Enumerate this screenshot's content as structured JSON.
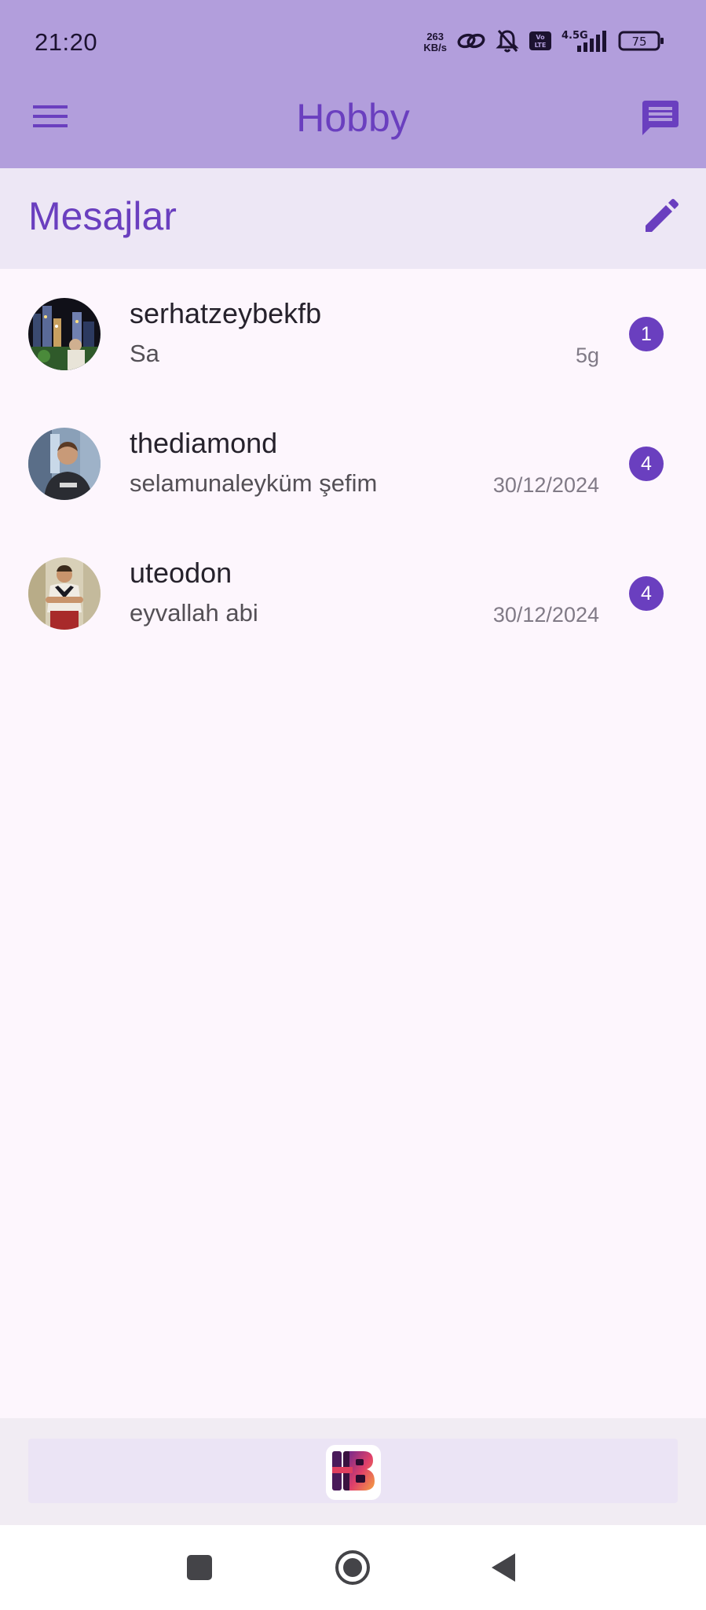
{
  "status_bar": {
    "time": "21:20",
    "net_speed_value": "263",
    "net_speed_unit": "KB/s",
    "network_type": "4.5G",
    "volte_label": "Vo LTE",
    "battery_level": "75",
    "icons": [
      "link-icon",
      "bell-off-icon",
      "volte-icon",
      "signal-icon",
      "battery-icon"
    ]
  },
  "app_bar": {
    "title": "Hobby",
    "menu_icon": "menu-icon",
    "action_icon": "chat-icon"
  },
  "section": {
    "title": "Mesajlar",
    "action_icon": "edit-icon"
  },
  "conversations": [
    {
      "name": "serhatzeybekfb",
      "last_message": "Sa",
      "time": "5g",
      "unread": "1"
    },
    {
      "name": "thediamond",
      "last_message": "selamunaleyküm şefim",
      "time": "30/12/2024",
      "unread": "4"
    },
    {
      "name": "uteodon",
      "last_message": "eyvallah abi",
      "time": "30/12/2024",
      "unread": "4"
    }
  ],
  "bottom_bar": {
    "logo_icon": "hobby-logo-icon"
  },
  "nav": {
    "icons": [
      "recents-icon",
      "home-icon",
      "back-icon"
    ]
  },
  "colors": {
    "app_bar_bg": "#b29edc",
    "accent": "#6a3fbf",
    "section_bg": "#ede7f5",
    "page_bg": "#fdf6fd"
  }
}
